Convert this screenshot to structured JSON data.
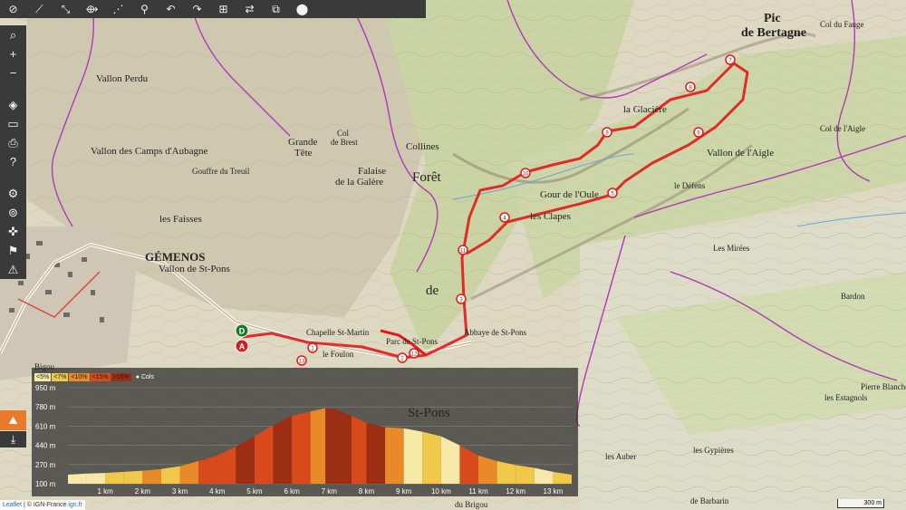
{
  "toolbar": {
    "icons": [
      "eye-off-icon",
      "measure-icon",
      "draw-line-icon",
      "route-icon",
      "node-icon",
      "cycle-icon",
      "undo-icon",
      "redo-icon",
      "grid-icon",
      "swap-icon",
      "copy-icon",
      "pin-icon"
    ],
    "glyphs": [
      "⊘",
      "⟋",
      "⤡",
      "⟴",
      "⋰",
      "⚲",
      "↶",
      "↷",
      "⊞",
      "⇄",
      "⧉",
      "⬤"
    ]
  },
  "sidebar": {
    "glyphs": [
      "⌕",
      "+",
      "−",
      "◈",
      "▭",
      "⎙",
      "?",
      "⚙",
      "⊚",
      "✜",
      "⚑",
      "⚠"
    ]
  },
  "map_labels": [
    {
      "text": "Pic",
      "cls": "peak"
    },
    {
      "text": "de Bertagne",
      "cls": "peak"
    },
    {
      "text": "Col du Fauge",
      "cls": "small"
    },
    {
      "text": "GÉMENOS",
      "cls": "town"
    },
    {
      "text": "Grande",
      "cls": "mid"
    },
    {
      "text": "Tête",
      "cls": "mid"
    },
    {
      "text": "Col",
      "cls": "small"
    },
    {
      "text": "de Brest",
      "cls": "small"
    },
    {
      "text": "Falaise",
      "cls": "mid"
    },
    {
      "text": "de la Galère",
      "cls": "mid"
    },
    {
      "text": "Gouffre du Treuil",
      "cls": "small"
    },
    {
      "text": "les Faisses",
      "cls": "mid"
    },
    {
      "text": "Vallon de St-Pons",
      "cls": "valley"
    },
    {
      "text": "Vallon de l'Aigle",
      "cls": "valley"
    },
    {
      "text": "Forêt",
      "cls": "big"
    },
    {
      "text": "de",
      "cls": "big"
    },
    {
      "text": "St-Pons",
      "cls": "big"
    },
    {
      "text": "Collines",
      "cls": "valley"
    },
    {
      "text": "la Glacière",
      "cls": "mid"
    },
    {
      "text": "Gour de l'Oule",
      "cls": "mid"
    },
    {
      "text": "les Clapes",
      "cls": "mid"
    },
    {
      "text": "Chapelle St-Martin",
      "cls": "small"
    },
    {
      "text": "le Foulon",
      "cls": "small"
    },
    {
      "text": "Abbaye de St-Pons",
      "cls": "small"
    },
    {
      "text": "Parc de St-Pons",
      "cls": "small"
    },
    {
      "text": "Les Mirées",
      "cls": "small"
    },
    {
      "text": "Bardon",
      "cls": "small"
    },
    {
      "text": "Pierre Blanche",
      "cls": "small"
    },
    {
      "text": "les Estagnols",
      "cls": "small"
    },
    {
      "text": "les Gypières",
      "cls": "small"
    },
    {
      "text": "les Auber",
      "cls": "small"
    },
    {
      "text": "du Brigou",
      "cls": "small"
    },
    {
      "text": "de Barbarin",
      "cls": "small"
    },
    {
      "text": "Vallon Perdu",
      "cls": "valley"
    },
    {
      "text": "Vallon des Camps d'Aubagne",
      "cls": "valley"
    },
    {
      "text": "Col de l'Aigle",
      "cls": "small"
    },
    {
      "text": "le Défens",
      "cls": "small"
    },
    {
      "text": "Bigou",
      "cls": "small"
    }
  ],
  "markers": {
    "depart": "D",
    "arrivee": "A",
    "waypoints": [
      "1",
      "2",
      "3",
      "4",
      "5",
      "6",
      "7",
      "8",
      "9",
      "10",
      "11",
      "12",
      "13"
    ]
  },
  "legend": {
    "swatches": [
      {
        "label": "<5%",
        "color": "#f6e9a7"
      },
      {
        "label": "<7%",
        "color": "#f1c94a"
      },
      {
        "label": "<10%",
        "color": "#e88a2a"
      },
      {
        "label": "<15%",
        "color": "#d84a1b"
      },
      {
        "label": ">15%",
        "color": "#9c2e14"
      }
    ],
    "cols_label": "Cols"
  },
  "chart_data": {
    "type": "area",
    "xlabel": "",
    "ylabel": "",
    "yticks": [
      "950 m",
      "780 m",
      "610 m",
      "440 m",
      "270 m",
      "100 m"
    ],
    "xticks": [
      "1 km",
      "2 km",
      "3 km",
      "4 km",
      "5 km",
      "6 km",
      "7 km",
      "8 km",
      "9 km",
      "10 km",
      "11 km",
      "12 km",
      "13 km"
    ],
    "ylim": [
      100,
      950
    ],
    "xlim": [
      0,
      13.5
    ],
    "x": [
      0,
      0.5,
      1,
      1.5,
      2,
      2.5,
      3,
      3.5,
      4,
      4.5,
      5,
      5.5,
      6,
      6.5,
      6.9,
      7.2,
      7.6,
      8,
      8.5,
      9,
      9.5,
      10,
      10.5,
      11,
      11.5,
      12,
      12.5,
      13,
      13.5
    ],
    "y": [
      180,
      190,
      195,
      205,
      215,
      230,
      255,
      300,
      350,
      430,
      520,
      620,
      700,
      740,
      770,
      755,
      700,
      640,
      600,
      590,
      560,
      520,
      440,
      350,
      300,
      265,
      240,
      205,
      180
    ],
    "slope_classes": [
      0,
      0,
      1,
      1,
      2,
      1,
      2,
      3,
      3,
      4,
      3,
      4,
      3,
      2,
      4,
      4,
      3,
      4,
      2,
      0,
      1,
      0,
      3,
      2,
      1,
      1,
      0,
      1
    ]
  },
  "attribution": {
    "leaflet": "Leaflet",
    "sep": " | © ",
    "ign": "IGN-France",
    "ignfr": "ign.fr"
  },
  "scale": "300 m"
}
